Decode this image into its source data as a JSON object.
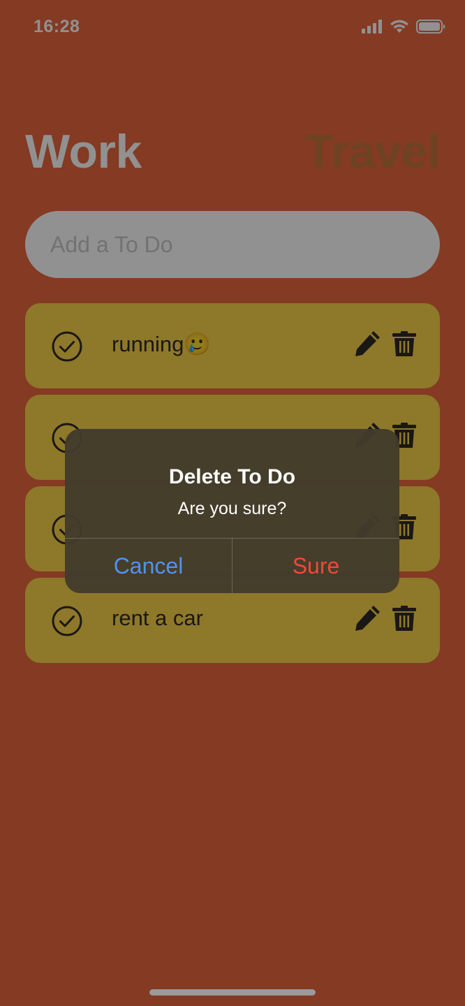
{
  "status_bar": {
    "time": "16:28"
  },
  "header": {
    "tab_work": "Work",
    "tab_travel": "Travel"
  },
  "input": {
    "placeholder": "Add a To Do"
  },
  "todos": [
    {
      "text": "running🥲"
    },
    {
      "text": ""
    },
    {
      "text": ""
    },
    {
      "text": "rent a car"
    }
  ],
  "alert": {
    "title": "Delete To Do",
    "message": "Are you sure?",
    "cancel_label": "Cancel",
    "confirm_label": "Sure"
  },
  "colors": {
    "background": "#E8663E",
    "card": "#FAD34A",
    "alert_cancel": "#4E93F2",
    "alert_confirm": "#F0483A"
  },
  "icons": [
    "signal-icon",
    "wifi-icon",
    "battery-icon",
    "check-circle-icon",
    "pencil-icon",
    "trash-icon"
  ]
}
